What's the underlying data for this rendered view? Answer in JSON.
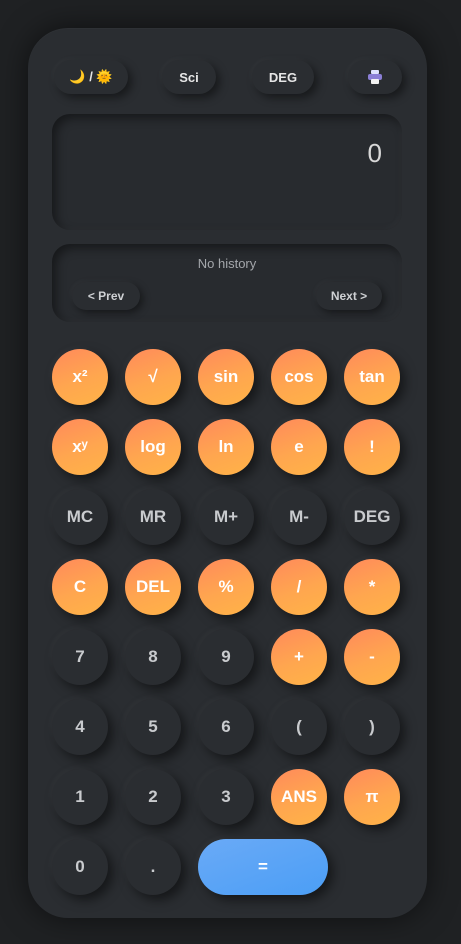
{
  "toolbar": {
    "theme_label": "🌙 / 🌞",
    "sci_label": "Sci",
    "deg_label": "DEG",
    "print_icon": "printer-icon"
  },
  "display": {
    "value": "0"
  },
  "history": {
    "empty_text": "No history",
    "prev_label": "< Prev",
    "next_label": "Next >"
  },
  "keys": {
    "square": "x²",
    "sqrt": "√",
    "sin": "sin",
    "cos": "cos",
    "tan": "tan",
    "power": "xʸ",
    "log": "log",
    "ln": "ln",
    "e": "e",
    "factorial": "!",
    "mc": "MC",
    "mr": "MR",
    "mplus": "M+",
    "mminus": "M-",
    "deg": "DEG",
    "clear": "C",
    "del": "DEL",
    "percent": "%",
    "divide": "/",
    "multiply": "*",
    "seven": "7",
    "eight": "8",
    "nine": "9",
    "plus": "+",
    "minus": "-",
    "four": "4",
    "five": "5",
    "six": "6",
    "lparen": "(",
    "rparen": ")",
    "one": "1",
    "two": "2",
    "three": "3",
    "ans": "ANS",
    "pi": "π",
    "zero": "0",
    "dot": ".",
    "equals": "="
  },
  "colors": {
    "accent_orange": "#ff9a50",
    "accent_blue": "#4b9ef5",
    "panel": "#2a2d31",
    "background": "#1f2123"
  }
}
